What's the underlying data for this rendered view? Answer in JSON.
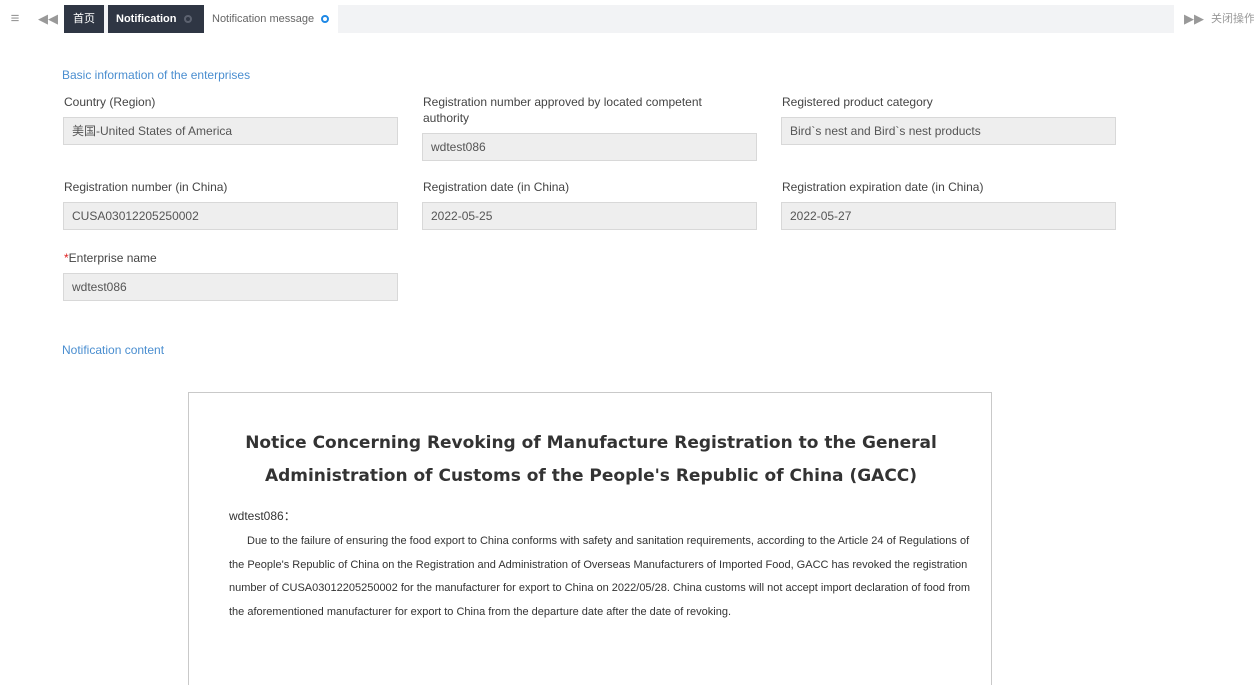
{
  "tabbar": {
    "menu_icon": "≡",
    "back_icon": "◀◀",
    "forward_icon": "▶▶",
    "tabs": [
      {
        "label": "首页"
      },
      {
        "label": "Notification"
      },
      {
        "label": "Notification message"
      }
    ],
    "close_ops_label": "关闭操作"
  },
  "basic_info": {
    "title": "Basic information of the enterprises",
    "fields": [
      {
        "label": "Country (Region)",
        "value": "美国-United States of America"
      },
      {
        "label": "Registration number approved by located competent authority",
        "value": "wdtest086"
      },
      {
        "label": "Registered product category",
        "value": "Bird`s nest and Bird`s nest products"
      },
      {
        "label": "Registration number (in China)",
        "value": "CUSA03012205250002"
      },
      {
        "label": "Registration date (in China)",
        "value": "2022-05-25"
      },
      {
        "label": "Registration expiration date (in China)",
        "value": "2022-05-27"
      },
      {
        "label": "Enterprise name",
        "value": "wdtest086",
        "required_mark": "*"
      }
    ]
  },
  "notification": {
    "section_title": "Notification content",
    "title_line1": "Notice Concerning Revoking of Manufacture Registration to the General",
    "title_line2": "Administration of Customs of the People's Republic of China (GACC)",
    "salutation": "wdtest086：",
    "body": "Due to the failure of ensuring the food export to China conforms with safety and sanitation requirements, according to the Article 24 of Regulations of the People's Republic of China on the Registration and Administration of Overseas Manufacturers of Imported Food, GACC has revoked the registration number of CUSA03012205250002 for the manufacturer for export to China on 2022/05/28. China customs will not accept import declaration of food from the aforementioned manufacturer for export to China from the departure date after the date of revoking."
  },
  "colors": {
    "tab_active_bg": "#2f3644",
    "section_title": "#4a8ed0",
    "field_bg": "#eeeeee",
    "required": "#e02020"
  }
}
